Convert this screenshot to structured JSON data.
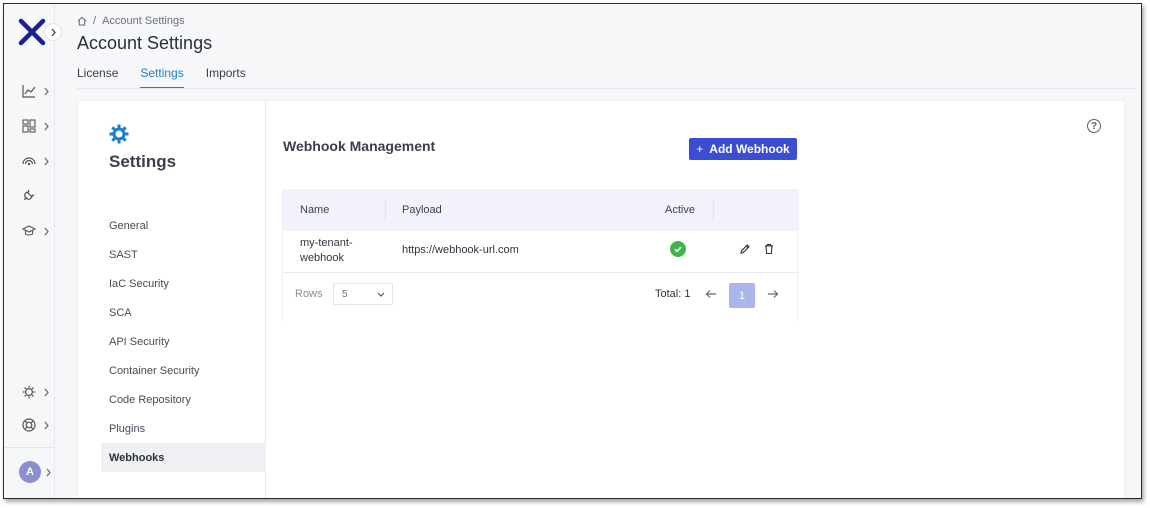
{
  "breadcrumb": {
    "current": "Account Settings"
  },
  "page_title": "Account Settings",
  "tabs": [
    {
      "label": "License",
      "active": false
    },
    {
      "label": "Settings",
      "active": true
    },
    {
      "label": "Imports",
      "active": false
    }
  ],
  "rail_icons": [
    "analytics-icon",
    "dashboard-icon",
    "signal-icon",
    "plug-icon",
    "learning-icon",
    "settings-icon",
    "help-ring-icon"
  ],
  "user": {
    "initial": "A"
  },
  "settings_nav": {
    "title": "Settings",
    "items": [
      {
        "label": "General"
      },
      {
        "label": "SAST"
      },
      {
        "label": "IaC Security"
      },
      {
        "label": "SCA"
      },
      {
        "label": "API Security"
      },
      {
        "label": "Container Security"
      },
      {
        "label": "Code Repository"
      },
      {
        "label": "Plugins"
      },
      {
        "label": "Webhooks",
        "active": true
      }
    ]
  },
  "webhooks": {
    "title": "Webhook Management",
    "add_label": "Add Webhook",
    "add_icon": "+",
    "columns": {
      "name": "Name",
      "payload": "Payload",
      "active": "Active"
    },
    "rows": [
      {
        "name_line1": "my-tenant-",
        "name_line2": "webhook",
        "payload": "https://webhook-url.com",
        "active": true
      }
    ],
    "pager": {
      "rows_label": "Rows",
      "rows_value": "5",
      "total_label": "Total: 1",
      "current_page": "1"
    }
  },
  "help_symbol": "?",
  "colors": {
    "accent": "#3b4ed1",
    "tab_active": "#1a7fd0",
    "success": "#3cb54a",
    "page_btn": "#a9b6ec"
  }
}
